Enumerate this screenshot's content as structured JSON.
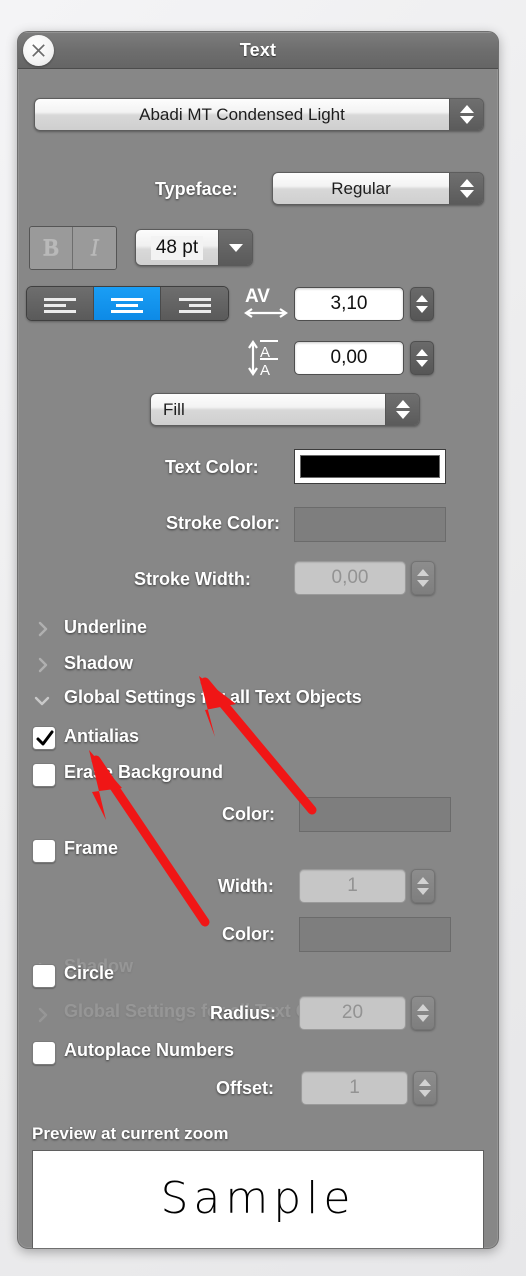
{
  "window": {
    "title": "Text",
    "close_icon": "close-circle-x-icon"
  },
  "font": {
    "family_value": "Abadi MT Condensed Light",
    "typeface_label": "Typeface:",
    "typeface_value": "Regular",
    "bold_label": "B",
    "italic_label": "I",
    "size_value": "48 pt"
  },
  "alignment": {
    "left_icon": "align-left-icon",
    "center_icon": "align-center-icon",
    "right_icon": "align-right-icon",
    "selected": "center",
    "selected_color": "#1a9ef5"
  },
  "spacing": {
    "kerning_icon": "kerning-av-icon",
    "kerning_value": "3,10",
    "leading_icon": "line-spacing-icon",
    "leading_value": "0,00"
  },
  "fill": {
    "mode_value": "Fill",
    "text_color_label": "Text Color:",
    "text_color_value": "#000000",
    "stroke_color_label": "Stroke Color:",
    "stroke_color_value": "#7e7e7e",
    "stroke_width_label": "Stroke Width:",
    "stroke_width_value": "0,00"
  },
  "sections": [
    {
      "label": "Underline",
      "expanded": false,
      "icon": "chevron-right-icon"
    },
    {
      "label": "Shadow",
      "expanded": false,
      "icon": "chevron-right-icon"
    },
    {
      "label": "Global Settings for all Text Objects",
      "expanded": true,
      "icon": "chevron-down-icon"
    }
  ],
  "global": {
    "antialias_label": "Antialias",
    "antialias_checked": true,
    "erase_background_label": "Erase Background",
    "erase_background_checked": false,
    "erase_color_label": "Color:",
    "erase_color_value": "#7e7e7e",
    "frame_label": "Frame",
    "frame_checked": false,
    "frame_width_label": "Width:",
    "frame_width_value": "1",
    "frame_color_label": "Color:",
    "frame_color_value": "#7e7e7e",
    "circle_label": "Circle",
    "circle_checked": false,
    "radius_label": "Radius:",
    "radius_value": "20",
    "autoplace_label": "Autoplace Numbers",
    "autoplace_checked": false,
    "offset_label": "Offset:",
    "offset_value": "1"
  },
  "ghost": {
    "shadow_label": "Shadow",
    "global_label": "Global Settings for all Text Objects"
  },
  "preview": {
    "caption": "Preview at current zoom",
    "sample_text": "Sample"
  },
  "annotations": {
    "arrow_color": "#f01616",
    "arrow_1_target": "Global Settings for all Text Objects",
    "arrow_2_target": "Erase Background"
  }
}
